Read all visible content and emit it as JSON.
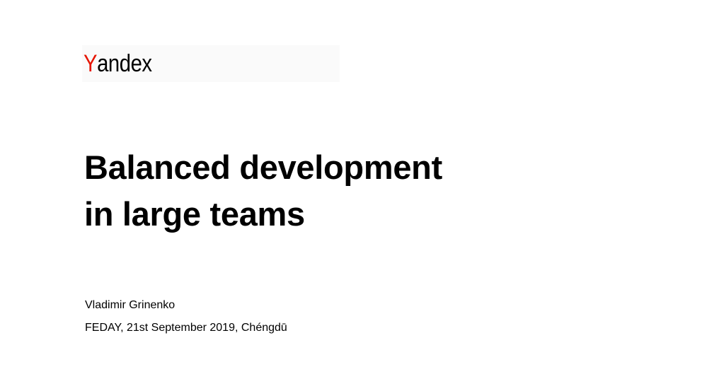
{
  "logo": {
    "first_letter": "Y",
    "rest": "andex",
    "accent_color": "#e61400"
  },
  "title": {
    "line1": "Balanced development",
    "line2": "in large teams"
  },
  "author": "Vladimir Grinenko",
  "event": "FEDAY, 21st September 2019, Chéngdū"
}
